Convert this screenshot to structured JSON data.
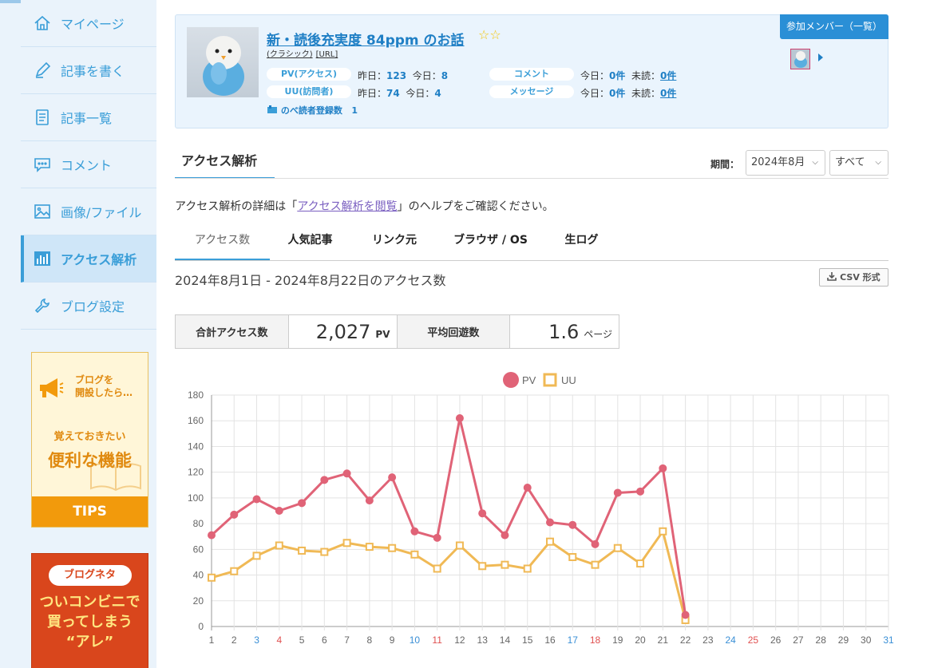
{
  "sidebar": {
    "items": [
      {
        "label": "マイページ",
        "icon": "home-icon"
      },
      {
        "label": "記事を書く",
        "icon": "pencil-icon"
      },
      {
        "label": "記事一覧",
        "icon": "document-list-icon"
      },
      {
        "label": "コメント",
        "icon": "comment-icon"
      },
      {
        "label": "画像/ファイル",
        "icon": "image-icon"
      },
      {
        "label": "アクセス解析",
        "icon": "bar-chart-icon"
      },
      {
        "label": "ブログ設定",
        "icon": "wrench-icon"
      }
    ],
    "active_index": 5,
    "banner1": {
      "line1": "ブログを",
      "line2": "開設したら…",
      "mid1": "覚えておきたい",
      "mid2": "便利な機能",
      "bottom": "TIPS"
    },
    "banner2": {
      "pill": "ブログネタ",
      "line1": "ついコンビニで",
      "line2": "買ってしまう",
      "line3": "“アレ”"
    }
  },
  "profile": {
    "title": "新・読後充実度 84ppm のお話",
    "classic_link": "(クラシック)",
    "url_link": "[URL]",
    "pv_label": "PV(アクセス)",
    "uu_label": "UU(訪問者)",
    "comment_label": "コメント",
    "message_label": "メッセージ",
    "yesterday_label": "昨日：",
    "today_label": "今日：",
    "unread_label": "未読：",
    "pv_yesterday": "123",
    "pv_today": "8",
    "uu_yesterday": "74",
    "uu_today": "4",
    "comment_today": "0件",
    "comment_unread": "0件",
    "message_today": "0件",
    "message_unread": "0件",
    "readers_label": "のべ読者登録数",
    "readers_count": "1",
    "members_button": "参加メンバー（一覧）"
  },
  "page": {
    "section_title": "アクセス解析",
    "period_label": "期間：",
    "period_month": "2024年8月",
    "period_filter": "すべて",
    "help_prefix": "アクセス解析の詳細は「",
    "help_link": "アクセス解析を閲覧",
    "help_suffix": "」のヘルプをご確認ください。",
    "tabs": [
      "アクセス数",
      "人気記事",
      "リンク元",
      "ブラウザ / OS",
      "生ログ"
    ],
    "range": "2024年8月1日 - 2024年8月22日のアクセス数",
    "csv_button": "CSV 形式",
    "total_label": "合計アクセス数",
    "total_value": "2,027",
    "total_unit": "PV",
    "avg_label": "平均回遊数",
    "avg_value": "1.6",
    "avg_unit": "ページ"
  },
  "chart_data": {
    "type": "line",
    "x": [
      1,
      2,
      3,
      4,
      5,
      6,
      7,
      8,
      9,
      10,
      11,
      12,
      13,
      14,
      15,
      16,
      17,
      18,
      19,
      20,
      21,
      22,
      23,
      24,
      25,
      26,
      27,
      28,
      29,
      30,
      31
    ],
    "series": [
      {
        "name": "PV",
        "color": "#e06377",
        "values": [
          71,
          87,
          99,
          90,
          96,
          114,
          119,
          98,
          116,
          74,
          69,
          162,
          88,
          71,
          108,
          81,
          79,
          64,
          104,
          105,
          123,
          9
        ]
      },
      {
        "name": "UU",
        "color": "#f0b955",
        "values": [
          38,
          43,
          55,
          63,
          59,
          58,
          65,
          62,
          61,
          56,
          45,
          63,
          47,
          48,
          45,
          66,
          54,
          48,
          61,
          49,
          74,
          5
        ]
      }
    ],
    "ylim": [
      0,
      180
    ],
    "yticks": [
      0,
      20,
      40,
      60,
      80,
      100,
      120,
      140,
      160,
      180
    ],
    "grid": true,
    "legend": "top-center",
    "saturday_days": [
      3,
      10,
      17,
      24,
      31
    ],
    "sunday_days": [
      4,
      11,
      18,
      25
    ],
    "saturday_color": "#3a8fd6",
    "sunday_color": "#e05050"
  }
}
